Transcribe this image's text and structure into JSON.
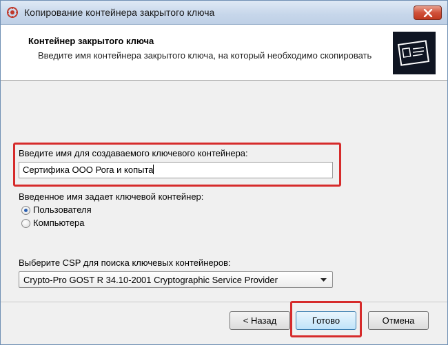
{
  "window": {
    "title": "Копирование контейнера закрытого ключа",
    "icon": "crypto-app-icon",
    "close_icon": "close-icon"
  },
  "header": {
    "title": "Контейнер закрытого ключа",
    "description": "Введите имя контейнера закрытого ключа, на который необходимо скопировать",
    "logo_icon": "certificate-icon"
  },
  "container_name": {
    "label": "Введите имя для создаваемого ключевого контейнера:",
    "value": "Сертифика ООО Рога и копыта"
  },
  "key_type": {
    "label": "Введенное имя задает ключевой контейнер:",
    "options": [
      {
        "label": "Пользователя",
        "checked": true
      },
      {
        "label": "Компьютера",
        "checked": false
      }
    ]
  },
  "csp": {
    "label": "Выберите CSP для поиска ключевых контейнеров:",
    "selected": "Crypto-Pro GOST R 34.10-2001 Cryptographic Service Provider"
  },
  "buttons": {
    "back": "< Назад",
    "finish": "Готово",
    "cancel": "Отмена"
  },
  "colors": {
    "highlight": "#d62b2b",
    "radio_selected": "#2a5fb0"
  }
}
